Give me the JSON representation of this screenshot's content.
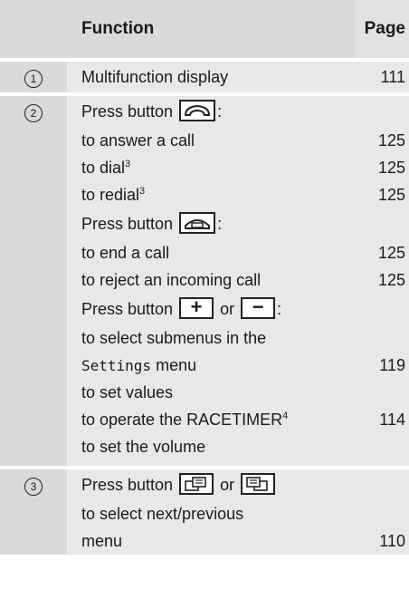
{
  "header": {
    "function": "Function",
    "page": "Page"
  },
  "row1": {
    "num": "1",
    "label": "Multifunction display",
    "page": "111"
  },
  "row2": {
    "num": "2",
    "press": "Press button",
    "colon": ":",
    "or": "or",
    "answer": "to answer a call",
    "answer_page": "125",
    "dial": "to dial",
    "dial_page": "125",
    "redial": "to redial",
    "redial_page": "125",
    "end": "to end a call",
    "end_page": "125",
    "reject": "to reject an incoming call",
    "reject_page": "125",
    "submenus": "to select submenus in the",
    "settings": "Settings",
    "menu_word": "menu",
    "settings_page": "119",
    "values": "to set values",
    "racetimer": "to operate the RACETIMER",
    "racetimer_page": "114",
    "volume": "to set the volume",
    "sup3": "3",
    "sup4": "4",
    "plus": "+",
    "minus": "−"
  },
  "row3": {
    "num": "3",
    "press": "Press button",
    "or": "or",
    "line2": "to select next/previous",
    "line3": "menu",
    "page": "110"
  },
  "icons": {
    "answer": "phone-answer-icon",
    "end": "phone-end-icon",
    "next": "menu-next-icon",
    "prev": "menu-previous-icon"
  }
}
